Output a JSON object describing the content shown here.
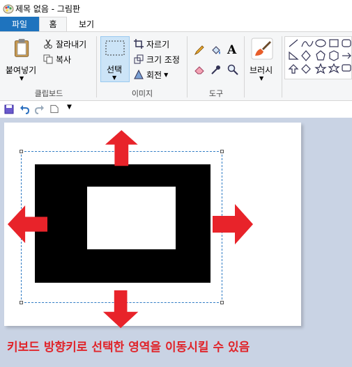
{
  "window": {
    "title": "제목 없음 - 그림판"
  },
  "tabs": {
    "file": "파일",
    "home": "홈",
    "view": "보기"
  },
  "clipboard": {
    "paste": "붙여넣기",
    "cut": "잘라내기",
    "copy": "복사",
    "group": "클립보드"
  },
  "image": {
    "select": "선택",
    "crop": "자르기",
    "resize": "크기 조정",
    "rotate": "회전",
    "group": "이미지"
  },
  "tools": {
    "group": "도구",
    "text_icon": "A"
  },
  "brushes": {
    "label": "브러시"
  },
  "caption": "키보드 방향키로 선택한 영역을 이동시킬 수 있음",
  "colors": {
    "accent": "#1e73be",
    "arrow": "#e8232a",
    "selection": "#2f7bc4",
    "canvas_bg": "#c9d3e4"
  },
  "icons": [
    "paint-app-icon",
    "clipboard-icon",
    "scissors-icon",
    "copy-icon",
    "select-icon",
    "crop-icon",
    "resize-icon",
    "rotate-icon",
    "pencil-icon",
    "fill-icon",
    "text-icon",
    "eraser-icon",
    "color-picker-icon",
    "magnifier-icon",
    "brush-icon",
    "save-icon",
    "undo-icon",
    "redo-icon",
    "new-page-icon",
    "customize-qat-icon"
  ]
}
